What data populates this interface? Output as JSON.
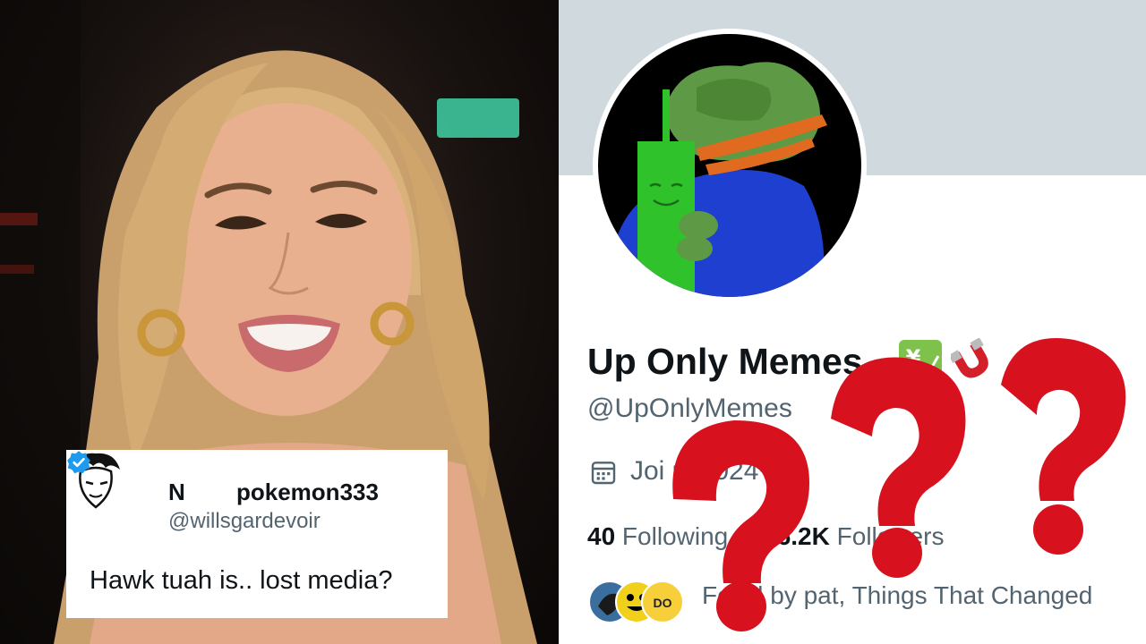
{
  "tweet": {
    "name_first": "N",
    "name_rest": "pokemon333",
    "handle": "@willsgardevoir",
    "text": "Hawk tuah is.. lost media?"
  },
  "profile": {
    "name": "Up Only Memes",
    "handle": "@UpOnlyMemes",
    "joined": "Joi         uly     024",
    "following_count": "40",
    "following_label": " Following",
    "followers_count": "396.2K",
    "followers_label": " Followers",
    "followed_by": "Foll      d by pat, Things That Changed"
  },
  "icons": [
    "verified-badge-icon",
    "calendar-icon",
    "yen-chart-emoji",
    "magnet-emoji",
    "question-mark-icon"
  ],
  "colors": {
    "banner": "#cfd9de",
    "verified": "#1d9bf0",
    "question_red": "#d8111e",
    "secondary_text": "#536471"
  }
}
